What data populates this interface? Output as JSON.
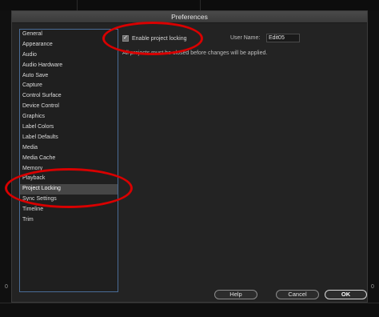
{
  "window": {
    "title": "Preferences"
  },
  "background": {
    "left_number": "0",
    "right_number": "0"
  },
  "sidebar": {
    "items": [
      {
        "label": "General"
      },
      {
        "label": "Appearance"
      },
      {
        "label": "Audio"
      },
      {
        "label": "Audio Hardware"
      },
      {
        "label": "Auto Save"
      },
      {
        "label": "Capture"
      },
      {
        "label": "Control Surface"
      },
      {
        "label": "Device Control"
      },
      {
        "label": "Graphics"
      },
      {
        "label": "Label Colors"
      },
      {
        "label": "Label Defaults"
      },
      {
        "label": "Media"
      },
      {
        "label": "Media Cache"
      },
      {
        "label": "Memory"
      },
      {
        "label": "Playback"
      },
      {
        "label": "Project Locking"
      },
      {
        "label": "Sync Settings"
      },
      {
        "label": "Timeline"
      },
      {
        "label": "Trim"
      }
    ],
    "selected_label": "Project Locking"
  },
  "panel": {
    "enable_locking_label": "Enable project locking",
    "enable_locking_checked": true,
    "user_name_label": "User Name:",
    "user_name_value": "Edit05",
    "info_text": "All projects must be closed before changes will be applied."
  },
  "buttons": {
    "help": "Help",
    "cancel": "Cancel",
    "ok": "OK"
  },
  "colors": {
    "annotation": "#d80000",
    "selection": "#464646",
    "list_border": "#4a6c96"
  },
  "icons": {
    "checkbox": "checkmark-icon"
  }
}
